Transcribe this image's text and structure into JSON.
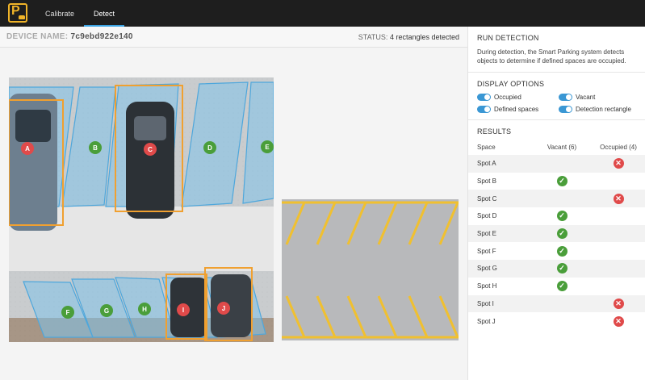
{
  "nav": {
    "tabs": [
      {
        "label": "Calibrate",
        "active": false
      },
      {
        "label": "Detect",
        "active": true
      }
    ]
  },
  "device": {
    "name_label": "DEVICE NAME:",
    "name_value": "7c9ebd922e140",
    "status_label": "STATUS:",
    "status_value": "4 rectangles detected"
  },
  "camera": {
    "spot_labels": [
      "A",
      "B",
      "C",
      "D",
      "E",
      "F",
      "G",
      "H",
      "I",
      "J"
    ],
    "occupied": [
      "A",
      "C",
      "I",
      "J"
    ]
  },
  "sidebar": {
    "run": {
      "title": "RUN DETECTION",
      "description": "During detection, the Smart Parking system detects objects to determine if defined spaces are occupied."
    },
    "display": {
      "title": "DISPLAY OPTIONS",
      "options": [
        {
          "label": "Occupied",
          "on": true
        },
        {
          "label": "Vacant",
          "on": true
        },
        {
          "label": "Defined spaces",
          "on": true
        },
        {
          "label": "Detection rectangle",
          "on": true
        }
      ]
    },
    "results": {
      "title": "RESULTS",
      "col_space": "Space",
      "col_vacant": "Vacant (6)",
      "col_occupied": "Occupied (4)",
      "rows": [
        {
          "space": "Spot A",
          "state": "occupied"
        },
        {
          "space": "Spot B",
          "state": "vacant"
        },
        {
          "space": "Spot C",
          "state": "occupied"
        },
        {
          "space": "Spot D",
          "state": "vacant"
        },
        {
          "space": "Spot E",
          "state": "vacant"
        },
        {
          "space": "Spot F",
          "state": "vacant"
        },
        {
          "space": "Spot G",
          "state": "vacant"
        },
        {
          "space": "Spot H",
          "state": "vacant"
        },
        {
          "space": "Spot I",
          "state": "occupied"
        },
        {
          "space": "Spot J",
          "state": "occupied"
        }
      ]
    }
  },
  "colors": {
    "accent": "#3a97d4",
    "vacant": "#4a9e3a",
    "occupied": "#e04a4a",
    "detection": "#f0a030",
    "topbar": "#1e1e1e"
  }
}
